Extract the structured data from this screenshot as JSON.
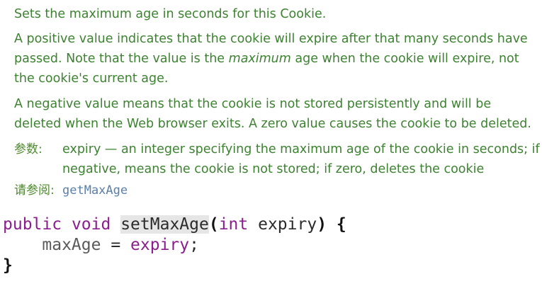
{
  "doc": {
    "summary": "Sets the maximum age in seconds for this Cookie.",
    "positive_before": "A positive value indicates that the cookie will expire after that many seconds have passed. Note that the value is the ",
    "positive_em": "maximum",
    "positive_after": " age when the cookie will expire, not the cookie's current age.",
    "negative": "A negative value means that the cookie is not stored persistently and will be deleted when the Web browser exits. A zero value causes the cookie to be deleted.",
    "params_label": "参数:",
    "params_text": "expiry — an integer specifying the maximum age of the cookie in seconds; if negative, means the cookie is not stored; if zero, deletes the cookie",
    "see_label": "请参阅:",
    "see_link": "getMaxAge"
  },
  "code": {
    "kw_public": "public",
    "kw_void": "void",
    "method_name": "setMaxAge",
    "open_paren": "(",
    "kw_int": "int",
    "param_name": "expiry",
    "close_paren_brace": ") {",
    "body_field": "maxAge",
    "body_eq": " = ",
    "body_value": "expiry",
    "body_semi": ";",
    "close_brace": "}"
  }
}
